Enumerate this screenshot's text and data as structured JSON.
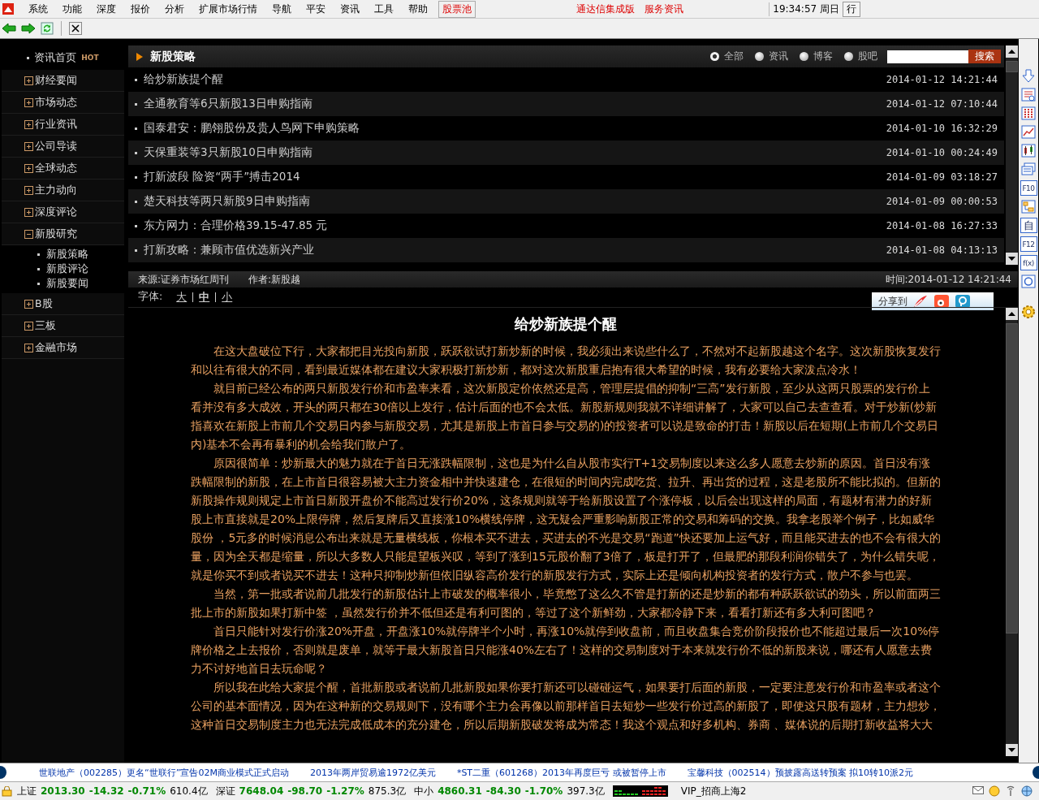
{
  "menu": [
    "系统",
    "功能",
    "深度",
    "报价",
    "分析",
    "扩展市场行情",
    "导航",
    "平安",
    "资讯",
    "工具",
    "帮助"
  ],
  "stock_pool": "股票池",
  "menu_links": [
    "通达信集成版",
    "服务资讯"
  ],
  "clock": "19:34:57 周日",
  "quote_button": "行",
  "sidebar": [
    {
      "kind": "home",
      "label": "资讯首页",
      "badge": "HOT"
    },
    {
      "kind": "group",
      "label": "财经要闻",
      "expanded": false
    },
    {
      "kind": "group",
      "label": "市场动态",
      "expanded": false
    },
    {
      "kind": "group",
      "label": "行业资讯",
      "expanded": false
    },
    {
      "kind": "group",
      "label": "公司导读",
      "expanded": false
    },
    {
      "kind": "group",
      "label": "全球动态",
      "expanded": false
    },
    {
      "kind": "group",
      "label": "主力动向",
      "expanded": false
    },
    {
      "kind": "group",
      "label": "深度评论",
      "expanded": false
    },
    {
      "kind": "group",
      "label": "新股研究",
      "expanded": true,
      "children": [
        {
          "label": "新股策略"
        },
        {
          "label": "新股评论"
        },
        {
          "label": "新股要闻"
        }
      ]
    },
    {
      "kind": "group",
      "label": "B股",
      "expanded": false
    },
    {
      "kind": "group",
      "label": "三板",
      "expanded": false
    },
    {
      "kind": "group",
      "label": "金融市场",
      "expanded": false
    }
  ],
  "section": {
    "title": "新股策略",
    "filters": [
      {
        "label": "全部",
        "selected": true
      },
      {
        "label": "资讯",
        "selected": false
      },
      {
        "label": "博客",
        "selected": false
      },
      {
        "label": "股吧",
        "selected": false
      }
    ],
    "search_button": "搜索"
  },
  "news": [
    {
      "title": "给炒新族提个醒",
      "time": "2014-01-12 14:21:44"
    },
    {
      "title": "全通教育等6只新股13日申购指南",
      "time": "2014-01-12 07:10:44"
    },
    {
      "title": "国泰君安：鹏翎股份及贵人鸟网下申购策略",
      "time": "2014-01-10 16:32:29"
    },
    {
      "title": "天保重装等3只新股10日申购指南",
      "time": "2014-01-10 00:24:49"
    },
    {
      "title": "打新波段 险资“两手”搏击2014",
      "time": "2014-01-09 03:18:27"
    },
    {
      "title": "楚天科技等两只新股9日申购指南",
      "time": "2014-01-09 00:00:53"
    },
    {
      "title": "东方网力：合理价格39.15-47.85 元",
      "time": "2014-01-08 16:27:33"
    },
    {
      "title": "打新攻略：兼顾市值优选新兴产业",
      "time": "2014-01-08 04:13:13"
    }
  ],
  "article": {
    "source": "来源:证券市场红周刊",
    "author": "作者:新股越",
    "time": "时间:2014-01-12 14:21:44",
    "font_label": "字体:",
    "font_sizes": [
      {
        "label": "大",
        "selected": false
      },
      {
        "label": "中",
        "selected": true
      },
      {
        "label": "小",
        "selected": false
      }
    ],
    "share_label": "分享到",
    "title": "给炒新族提个醒",
    "paragraphs": [
      "在这大盘破位下行，大家都把目光投向新股，跃跃欲试打新炒新的时候，我必须出来说些什么了，不然对不起新股越这个名字。这次新股恢复发行和以往有很大的不同，看到最近媒体都在建议大家积极打新炒新，都对这次新股重启抱有很大希望的时候，我有必要给大家泼点冷水！",
      "就目前已经公布的两只新股发行价和市盈率来看，这次新股定价依然还是高，管理层提倡的抑制“三高”发行新股，至少从这两只股票的发行价上看并没有多大成效，开头的两只都在30倍以上发行，估计后面的也不会太低。新股新规则我就不详细讲解了，大家可以自己去查查看。对于炒新(炒新指喜欢在新股上市前几个交易日内参与新股交易，尤其是新股上市首日参与交易的)的投资者可以说是致命的打击！新股以后在短期(上市前几个交易日内)基本不会再有暴利的机会给我们散户了。",
      "原因很简单：炒新最大的魅力就在于首日无涨跌幅限制，这也是为什么自从股市实行T+1交易制度以来这么多人愿意去炒新的原因。首日没有涨跌幅限制的新股，在上市首日很容易被大主力资金相中并快速建仓，在很短的时间内完成吃货、拉升、再出货的过程，这是老股所不能比拟的。但新的新股操作规则规定上市首日新股开盘价不能高过发行价20%，这条规则就等于给新股设置了个涨停板，以后会出现这样的局面，有题材有潜力的好新股上市直接就是20%上限停牌，然后复牌后又直接涨10%横线停牌，这无疑会严重影响新股正常的交易和筹码的交换。我拿老股举个例子，比如威华股份 ，5元多的时候消息公布出来就是无量横线板，你根本买不进去，买进去的不光是交易“跑道”快还要加上运气好，而且能买进去的也不会有很大的量，因为全天都是缩量，所以大多数人只能是望板兴叹，等到了涨到15元股价翻了3倍了，板是打开了，但最肥的那段利润你错失了，为什么错失呢，就是你买不到或者说买不进去！这种只抑制炒新但依旧纵容高价发行的新股发行方式，实际上还是倾向机构投资者的发行方式，散户不参与也罢。",
      "当然，第一批或者说前几批发行的新股估计上市破发的概率很小，毕竟憋了这么久不管是打新的还是炒新的都有种跃跃欲试的劲头，所以前面两三批上市的新股如果打新中签 ，虽然发行价并不低但还是有利可图的，等过了这个新鲜劲，大家都冷静下来，看看打新还有多大利可图吧？",
      "首日只能针对发行价涨20%开盘，开盘涨10%就停牌半个小时，再涨10%就停到收盘前，而且收盘集合竞价阶段报价也不能超过最后一次10%停牌价格之上去报价，否则就是废单，就等于最大新股首日只能涨40%左右了！这样的交易制度对于本来就发行价不低的新股来说，哪还有人愿意去费力不讨好地首日去玩命呢？",
      "所以我在此给大家提个醒，首批新股或者说前几批新股如果你要打新还可以碰碰运气，如果要打后面的新股，一定要注意发行价和市盈率或者这个公司的基本面情况，因为在这种新的交易规则下，没有哪个主力会再像以前那样首日去短炒一些发行价过高的新股了，即使这只股有题材，主力想炒，这种首日交易制度主力也无法完成低成本的充分建仓，所以后期新股破发将成为常态！我这个观点和好多机构、券商 、媒体说的后期打新收益将大大"
    ]
  },
  "right_tools": [
    {
      "kind": "down"
    },
    {
      "kind": "table"
    },
    {
      "kind": "grid"
    },
    {
      "kind": "line"
    },
    {
      "kind": "candle"
    },
    {
      "kind": "windows"
    },
    {
      "kind": "text",
      "label": "F10"
    },
    {
      "kind": "tree"
    },
    {
      "kind": "text",
      "label": "自"
    },
    {
      "kind": "text",
      "label": "F12"
    },
    {
      "kind": "text",
      "label": "f(x)"
    },
    {
      "kind": "circle"
    }
  ],
  "ticker": [
    "世联地产（002285）更名“世联行”宣告02M商业模式正式启动",
    "2013年两岸贸易逾1972亿美元",
    "*ST二重（601268）2013年再度巨亏 或被暂停上市",
    "宝馨科技（002514）预披露高送转预案 拟10转10派2元"
  ],
  "indices": [
    {
      "name": "上证",
      "value": "2013.30",
      "change": "-14.32",
      "pct": "-0.71%",
      "amount": "610.4亿"
    },
    {
      "name": "深证",
      "value": "7648.04",
      "change": "-98.70",
      "pct": "-1.27%",
      "amount": "875.3亿"
    },
    {
      "name": "中小",
      "value": "4860.31",
      "change": "-84.30",
      "pct": "-1.70%",
      "amount": "397.3亿"
    }
  ],
  "account": "VIP_招商上海2"
}
